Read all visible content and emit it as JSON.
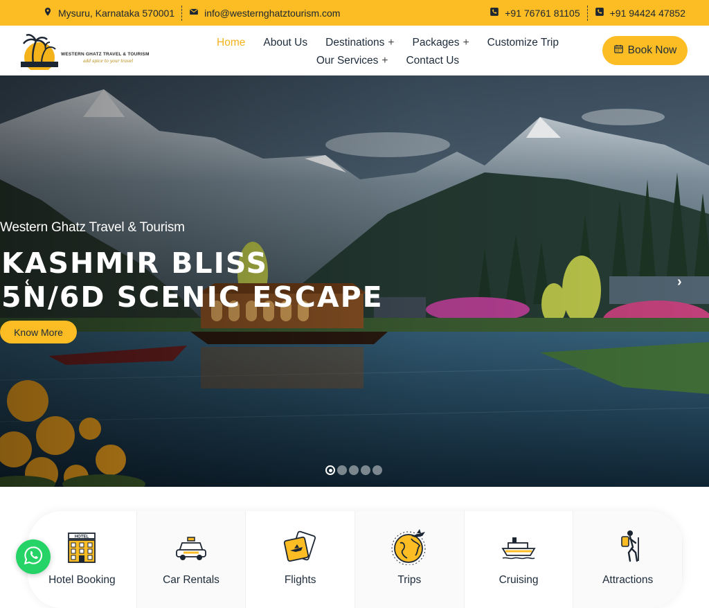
{
  "topbar": {
    "address": "Mysuru, Karnataka 570001",
    "email": "info@westernghatztourism.com",
    "phone1": "+91 76761 81105",
    "phone2": "+91 94424 47852"
  },
  "logo": {
    "brand": "WESTERN GHATZ TRAVEL & TOURISM",
    "tagline": "add spice to your travel"
  },
  "nav": {
    "items": [
      {
        "label": "Home",
        "active": true
      },
      {
        "label": "About Us"
      },
      {
        "label": "Destinations"
      },
      {
        "label": "Packages"
      },
      {
        "label": "Customize Trip"
      },
      {
        "label": "Our Services"
      },
      {
        "label": "Contact Us"
      }
    ]
  },
  "book_now": "Book Now",
  "hero": {
    "subtitle": "Western Ghatz Travel & Tourism",
    "title_line1": "KASHMIR BLISS",
    "title_line2": "5N/6D SCENIC ESCAPE",
    "cta": "Know More",
    "prev": "‹",
    "next": "›",
    "slide_count": 5,
    "active_slide": 1
  },
  "services": [
    {
      "label": "Hotel Booking",
      "icon": "hotel-icon"
    },
    {
      "label": "Car Rentals",
      "icon": "taxi-icon"
    },
    {
      "label": "Flights",
      "icon": "plane-ticket-icon"
    },
    {
      "label": "Trips",
      "icon": "globe-plane-icon"
    },
    {
      "label": "Cruising",
      "icon": "ship-icon"
    },
    {
      "label": "Attractions",
      "icon": "hiker-icon"
    }
  ],
  "colors": {
    "accent": "#fbbd23",
    "text": "#1d2b3a",
    "whatsapp": "#25d366"
  }
}
